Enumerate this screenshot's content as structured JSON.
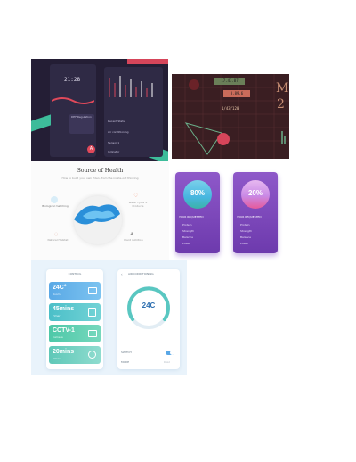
{
  "dark_dashboard": {
    "time": "21:28",
    "detail_label": "DEF Regulation",
    "alert_symbol": "A"
  },
  "control_panel_dark": {
    "label_1": "Recent Stats",
    "label_2": "Air conditioning",
    "label_3": "Sensor 1",
    "label_4": "Indicator"
  },
  "retro": {
    "row_1": "17.43.07",
    "row_2": "0.89.6",
    "row_3": "1/43/120",
    "glyph_1": "M",
    "glyph_2": "2"
  },
  "health": {
    "title": "Source of Health",
    "subtitle": "How to build your own Eden, from the inside-out thinking",
    "item_1": "Biological matching",
    "item_2": "Water cycle + Products",
    "item_3": "Natural Habitat",
    "item_4": "Plant nutrition"
  },
  "purple_cards": [
    {
      "percent": "80%",
      "label": "YOUR REQUESTED",
      "rows": [
        "Protein",
        "Strength",
        "Balance",
        "Power"
      ]
    },
    {
      "percent": "20%",
      "label": "YOUR REQUESTED",
      "rows": [
        "Protein",
        "Strength",
        "Balance",
        "Power"
      ]
    }
  ],
  "control": {
    "title": "CONTROL",
    "items": [
      {
        "value": "24C°",
        "sub": "Room"
      },
      {
        "value": "45mins",
        "sub": "Timer"
      },
      {
        "value": "CCTV-1",
        "sub": "Camera"
      },
      {
        "value": "20mins",
        "sub": "Timer"
      }
    ]
  },
  "aircon": {
    "title": "AIR CONDITIONING",
    "temp": "24C",
    "switch_label": "SWITCH",
    "mode_label": "MODE",
    "mode_value": "Cool"
  },
  "colors": {
    "dark_bg": "#241e35",
    "retro_bg": "#3a1e22",
    "purple": "#8e58c9",
    "blue": "#5aa9e6",
    "teal": "#4ec8b8"
  }
}
